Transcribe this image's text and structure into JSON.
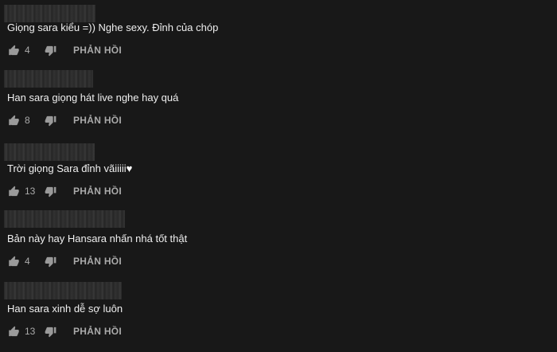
{
  "comments": [
    {
      "text": "Giọng sara kiểu =)) Nghe sexy. Đỉnh của chóp",
      "likes": "4",
      "reply_label": "PHẢN HỒI"
    },
    {
      "text": "Han sara giọng hát live nghe hay quá",
      "likes": "8",
      "reply_label": "PHẢN HỒI"
    },
    {
      "text": "Trời giọng Sara đỉnh vãiiiii",
      "emoji": "♥",
      "likes": "13",
      "reply_label": "PHẢN HỒI"
    },
    {
      "text": "Bản này hay Hansara nhấn nhá tốt thật",
      "likes": "4",
      "reply_label": "PHẢN HỒI"
    },
    {
      "text": "Han sara xinh dễ sợ luôn",
      "likes": "13",
      "reply_label": "PHẢN HỒI"
    }
  ],
  "icons": {
    "like": "thumbs-up-icon",
    "dislike": "thumbs-down-icon"
  },
  "colors": {
    "background": "#181818",
    "text": "#efefef",
    "muted": "#aaaaaa"
  }
}
